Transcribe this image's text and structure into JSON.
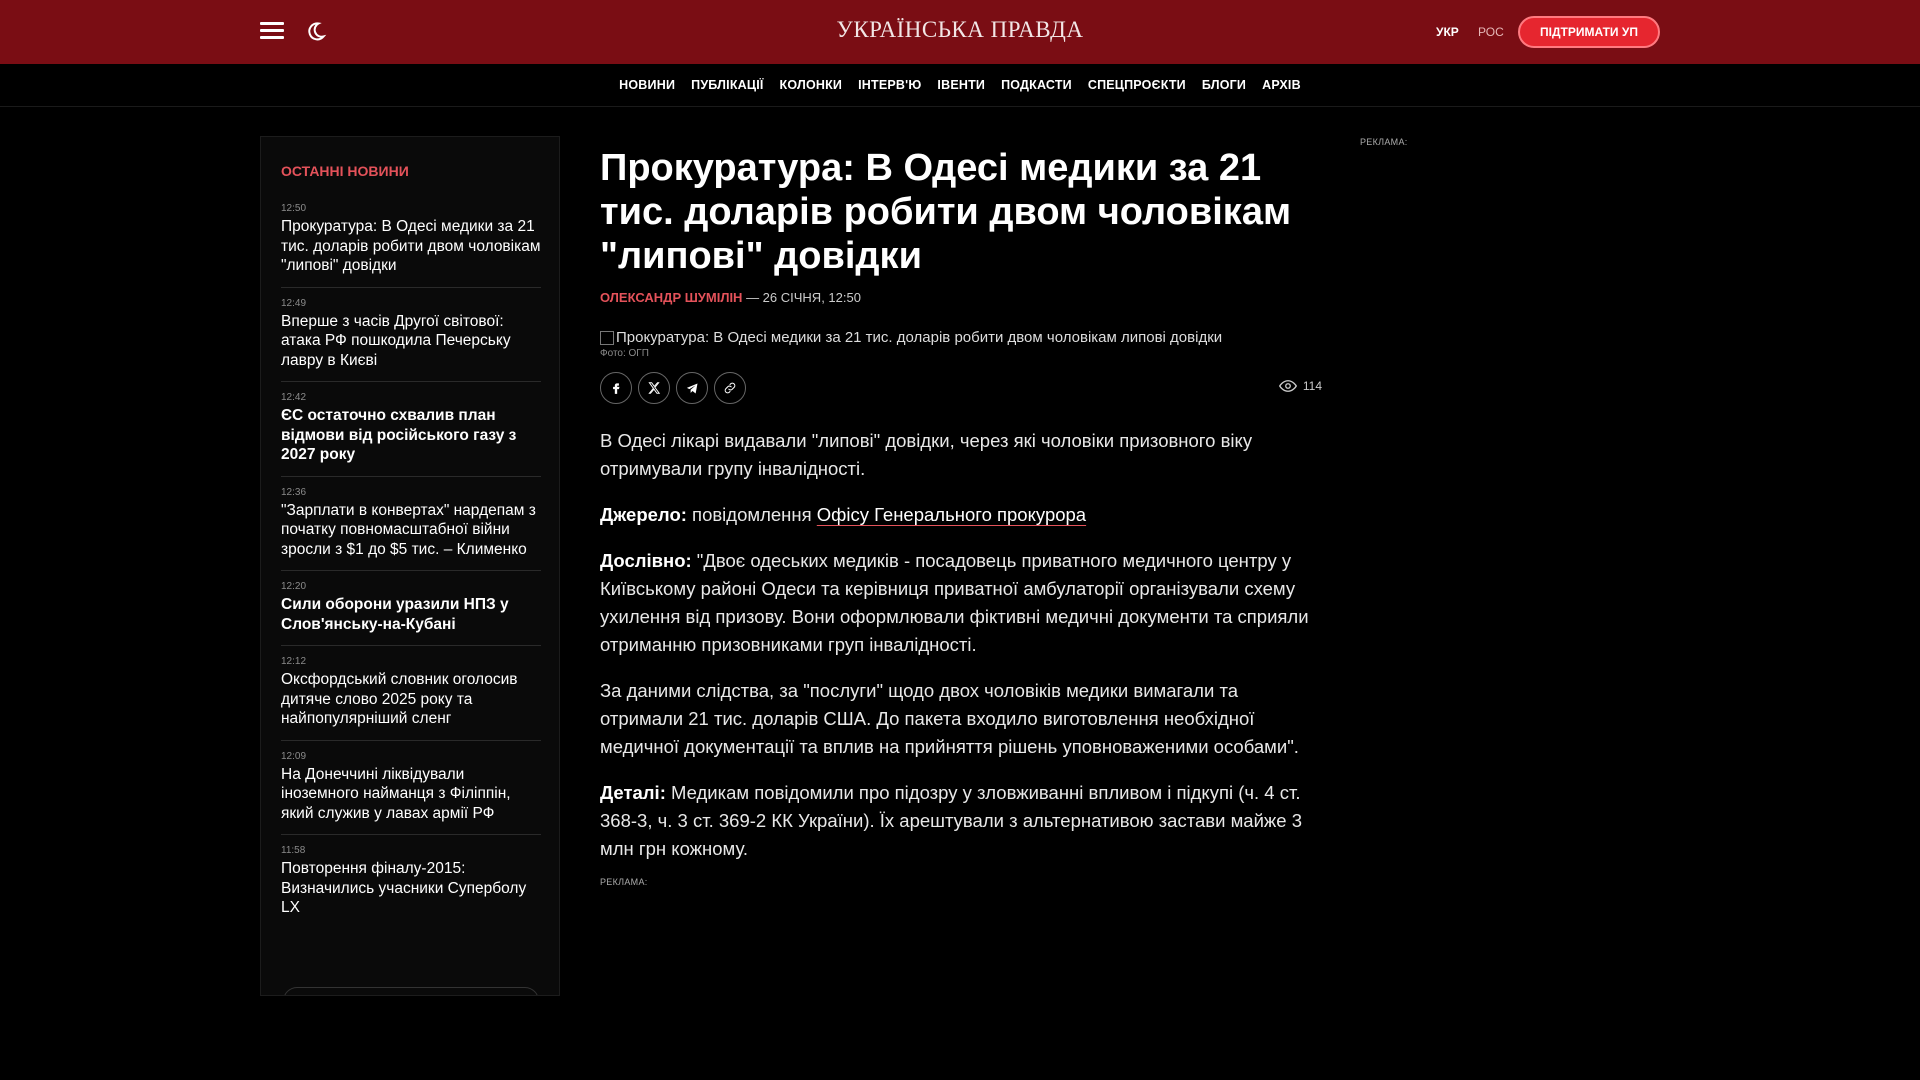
{
  "header": {
    "logo": "УКРАЇНСЬКА ПРАВДА",
    "lang_ukr": "УКР",
    "lang_ros": "РОС",
    "support_label": "ПІДТРИМАТИ УП"
  },
  "nav": {
    "items": [
      "НОВИНИ",
      "ПУБЛІКАЦІЇ",
      "КОЛОНКИ",
      "ІНТЕРВ'Ю",
      "ІВЕНТИ",
      "ПОДКАСТИ",
      "СПЕЦПРОЄКТИ",
      "БЛОГИ",
      "АРХІВ"
    ]
  },
  "sidebar": {
    "title": "ОСТАННІ НОВИНИ",
    "items": [
      {
        "time": "12:50",
        "title": "Прокуратура: В Одесі медики за 21 тис. доларів робити двом чоловікам \"липові\" довідки"
      },
      {
        "time": "12:49",
        "title": "Вперше з часів Другої світової: атака РФ пошкодила Печерську лавру в Києві"
      },
      {
        "time": "12:42",
        "title": "ЄС остаточно схвалив план відмови від російського газу з 2027 року"
      },
      {
        "time": "12:36",
        "title": "\"Зарплати в конвертах\" нардепам з початку повномасштабної війни зросли з $1 до $5 тис. – Клименко"
      },
      {
        "time": "12:20",
        "title": "Сили оборони уразили НПЗ у Слов'янську-на-Кубані"
      },
      {
        "time": "12:12",
        "title": "Оксфордський словник оголосив дитяче слово 2025 року та найпопулярніший сленг"
      },
      {
        "time": "12:09",
        "title": "На Донеччині ліквідували іноземного найманця з Філіппін, який служив у лавах армії РФ"
      },
      {
        "time": "11:58",
        "title": "Повторення фіналу-2015: Визначились учасники Суперболу LX"
      }
    ]
  },
  "article": {
    "headline": "Прокуратура: В Одесі медики за 21 тис. доларів робити двом чоловікам \"липові\" довідки",
    "author": "ОЛЕКСАНДР ШУМІЛІН",
    "date": " — 26 СІЧНЯ, 12:50",
    "image_alt": "Прокуратура: В Одесі медики за 21 тис. доларів робити двом чоловікам липові довідки",
    "photo_credit": "Фото: ОГП",
    "views": "114",
    "p1": "В Одесі лікарі видавали \"липові\" довідки, через які чоловіки призовного віку отримували групу інвалідності.",
    "source_label": "Джерело:",
    "source_text": " повідомлення ",
    "source_link": "Офісу Генерального прокурора",
    "quote_label": "Дослівно:",
    "quote_text": " \"Двоє одеських медиків - посадовець приватного медичного центру у Київському районі Одеси та керівниця приватної амбулаторії організували схему ухилення від призову. Вони оформлювали фіктивні медичні документи та сприяли отриманню призовниками груп інвалідності.",
    "p4": "За даними слідства, за \"послуги\" щодо двох чоловіків медики вимагали та отримали 21 тис. доларів США. До пакета входило виготовлення необхідної медичної документації та вплив на прийняття рішень уповноваженими особами\".",
    "details_label": "Деталі:",
    "details_text": " Медикам повідомили про підозру у зловживанні впливом і підкупі (ч. 4 ст. 368-3, ч. 3 ст. 369-2 КК України). Їх арештували з альтернативою застави майже 3 млн грн кожному."
  },
  "ads": {
    "label": "РЕКЛАМА:"
  },
  "colors": {
    "header_bg": "#7a0d14",
    "accent": "#e4525a",
    "support_bg": "#e6262f"
  }
}
